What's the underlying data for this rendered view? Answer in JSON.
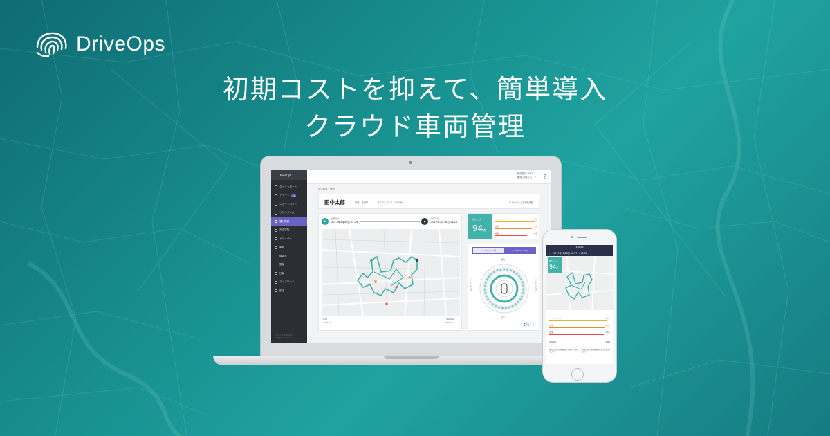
{
  "brand": {
    "name": "DriveOps"
  },
  "hero": {
    "line1": "初期コストを抑えて、簡単導入",
    "line2": "クラウド車両管理"
  },
  "app": {
    "brand": "DriveOps",
    "sidebar": {
      "items": [
        {
          "label": "ダッシュボード",
          "active": false
        },
        {
          "label": "アラート",
          "badge": "12",
          "active": false
        },
        {
          "label": "ショートロット",
          "active": false
        },
        {
          "label": "リアルタイム",
          "active": false
        },
        {
          "label": "運行解説",
          "active": true
        },
        {
          "label": "安全運転",
          "active": false
        },
        {
          "label": "ドライバー",
          "active": false
        },
        {
          "label": "車両",
          "active": false
        },
        {
          "label": "機能書",
          "active": false
        },
        {
          "label": "整備",
          "active": false
        },
        {
          "label": "日報",
          "active": false
        },
        {
          "label": "アップロード",
          "active": false
        },
        {
          "label": "設定",
          "active": false
        }
      ],
      "footer1": "©2017 DriveOps Inc.",
      "footer2": "All Rights Reserved."
    },
    "topbar": {
      "company": "株式会社 NAO",
      "user": "管理 太郎さん",
      "help": "?"
    },
    "breadcrumb": "走行履歴 / 詳細",
    "driver": {
      "name": "田中太郎",
      "meta1": "車両：社用車１",
      "meta2": "デバイスコード：000060",
      "link": "Ai Scoreによる運転診断"
    },
    "trip": {
      "start_label": "出発時刻",
      "start_time": "2017年3月30日 12:29",
      "end_label": "到着時刻",
      "end_time": "2017年3月30日 14:10",
      "distance_label": "距離",
      "distance": "24.5 km",
      "duration_label": "運転時間",
      "duration": "00:01:10"
    },
    "score": {
      "label": "総合スコア",
      "value": "94",
      "unit": "点"
    },
    "bars": [
      {
        "label": "ハンドリング",
        "value": "94点",
        "color": "#e2b23b",
        "fraction": 0.94
      },
      {
        "label": "加速",
        "value": "87点",
        "color": "#e88a3a",
        "fraction": 0.87
      },
      {
        "label": "減速",
        "value": "76点",
        "color": "#e2494e",
        "fraction": 0.76
      }
    ],
    "ring": {
      "tab_a": "イベント一覧",
      "tab_b": "G-Force Map",
      "top": "発進",
      "bottom": "停車",
      "left": "ハンドリング",
      "right": "ハンドリング",
      "legend1": "● 警告ゾーン",
      "legend2": "● 危険ゾーン"
    }
  },
  "phone": {
    "status": "9:41 AM",
    "nav_title": "2017年7月18日 12:57 ～ 13:58",
    "score_label": "総合スコア",
    "score_value": "94",
    "score_unit": "点",
    "bars": [
      {
        "label": "ハンドリング",
        "value": "94点",
        "color": "#e2b23b",
        "fraction": 0.94
      },
      {
        "label": "加速",
        "value": "92点",
        "color": "#e88a3a",
        "fraction": 0.92
      },
      {
        "label": "減速",
        "value": "90点",
        "color": "#e2494e",
        "fraction": 0.9
      }
    ],
    "distance": "264km",
    "duration": "1:01",
    "note_left": "車両の加速で推奨範囲以上を大きく超えています",
    "note_right": "車両の減速で推奨範囲をわずかに超えています"
  },
  "colors": {
    "accent": "#6a62c4",
    "teal": "#43b2ab",
    "bg_teal": "#178c8d"
  }
}
